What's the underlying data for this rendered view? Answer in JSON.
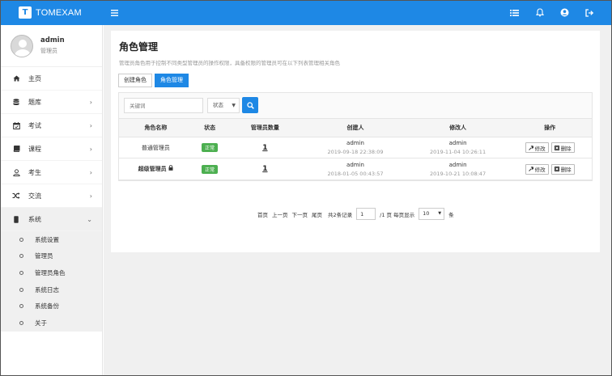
{
  "app": {
    "logo_mark": "T",
    "name": "TOMEXAM"
  },
  "header": {
    "icons": [
      "list-icon",
      "bell-icon",
      "user-circle-icon",
      "sign-out-icon"
    ]
  },
  "user": {
    "name": "admin",
    "role": "管理员"
  },
  "sidebar": {
    "items": [
      {
        "label": "主页",
        "icon": "home-icon"
      },
      {
        "label": "题库",
        "icon": "database-icon",
        "chevron": "›"
      },
      {
        "label": "考试",
        "icon": "calendar-icon",
        "chevron": "›"
      },
      {
        "label": "课程",
        "icon": "book-icon",
        "chevron": "›"
      },
      {
        "label": "考生",
        "icon": "user-icon",
        "chevron": "›"
      },
      {
        "label": "交流",
        "icon": "shuffle-icon",
        "chevron": "›"
      },
      {
        "label": "系统",
        "icon": "phone-icon",
        "chevron": "⌄"
      }
    ],
    "submenu": [
      "系统设置",
      "管理员",
      "管理员角色",
      "系统日志",
      "系统备份",
      "关于"
    ]
  },
  "page": {
    "title": "角色管理",
    "description": "管理员角色用于控制不同类型管理员的操作权限，具备权限的管理员可在以下列表管理相关角色",
    "tabs": [
      "创建角色",
      "角色管理"
    ]
  },
  "search": {
    "placeholder": "关键词",
    "status_label": "状态",
    "caret": "▼"
  },
  "table": {
    "headers": [
      "角色名称",
      "状态",
      "管理员数量",
      "创建人",
      "修改人",
      "操作"
    ],
    "rows": [
      {
        "name": "普通管理员",
        "status": "正常",
        "count": "1",
        "creator": "admin",
        "created": "2019-09-18 22:38:09",
        "modifier": "admin",
        "modified": "2019-11-04 10:26:11",
        "locked": false
      },
      {
        "name": "超级管理员",
        "status": "正常",
        "count": "1",
        "creator": "admin",
        "created": "2018-01-05 00:43:57",
        "modifier": "admin",
        "modified": "2019-10-21 10:08:47",
        "locked": true
      }
    ],
    "edit_label": "修改",
    "delete_label": "删除"
  },
  "pager": {
    "first": "首页",
    "prev": "上一页",
    "next": "下一页",
    "last": "尾页",
    "total": "共2条记录",
    "page_value": "1",
    "page_total": "/1 页 每页显示",
    "page_size": "10",
    "caret": "▼",
    "unit": "条"
  }
}
